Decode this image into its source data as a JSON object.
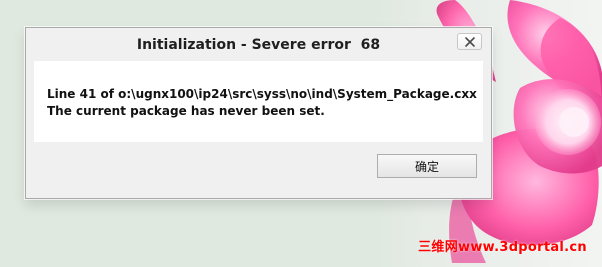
{
  "dialog": {
    "title": "Initialization - Severe error  68",
    "message_line_1": "Line 41 of o:\\ugnx100\\ip24\\src\\syss\\no\\ind\\System_Package.cxx",
    "message_line_2": "The current package has never been set.",
    "ok_button_label": "确定"
  },
  "watermark": {
    "text": "三维网www.3dportal.cn"
  },
  "colors": {
    "flower_pink": "#ff4fa0",
    "flower_light_pink": "#ff9fd0",
    "dialog_background": "#f0f0f0",
    "content_background": "#ffffff",
    "watermark_red": "#ff0000"
  }
}
